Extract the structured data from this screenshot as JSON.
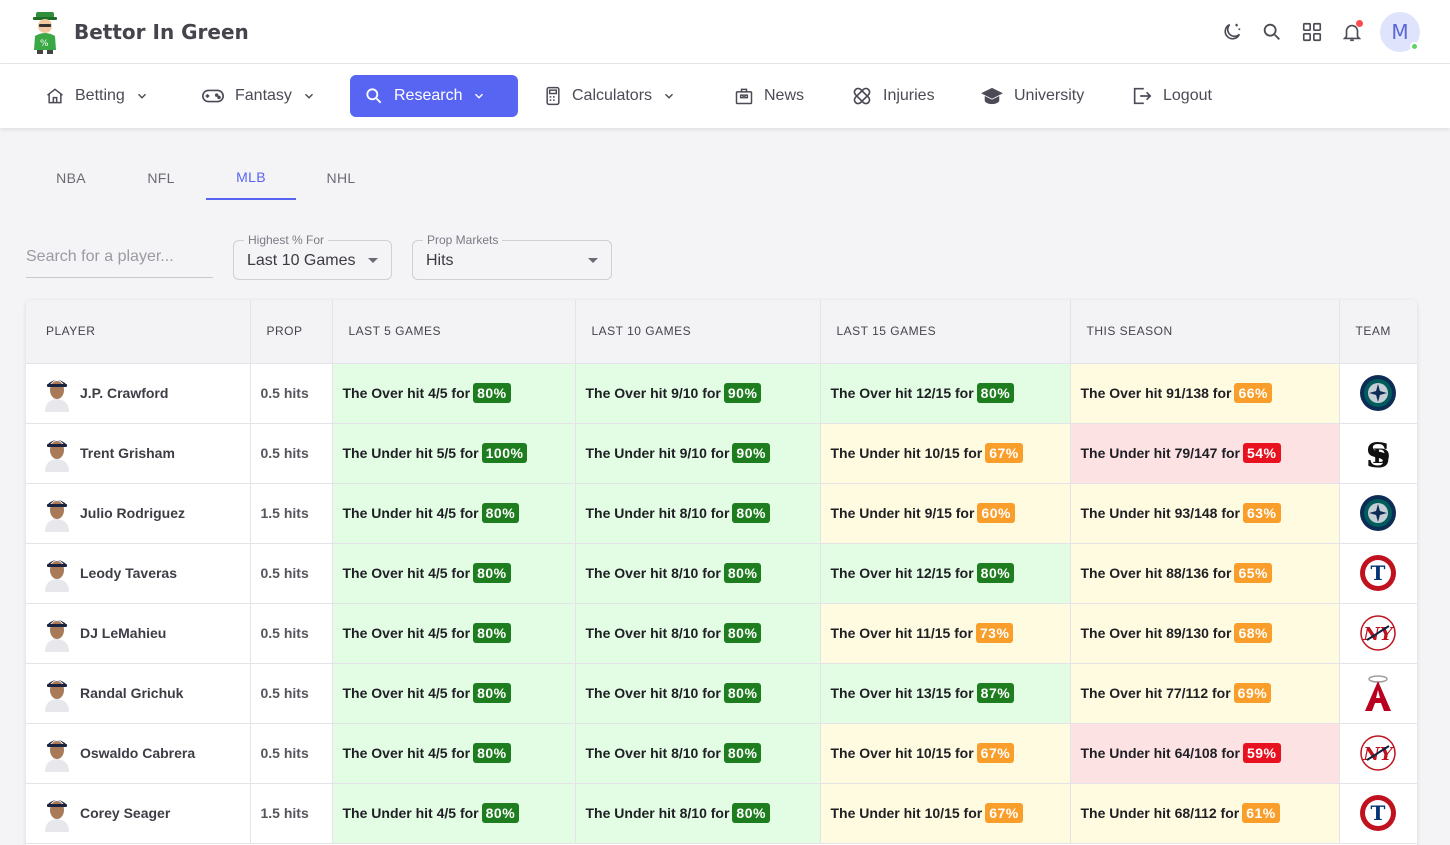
{
  "brand": {
    "name": "Bettor In Green"
  },
  "header": {
    "avatar_initial": "M"
  },
  "nav": [
    {
      "label": "Betting",
      "icon": "home-icon",
      "dropdown": true
    },
    {
      "label": "Fantasy",
      "icon": "gamepad-icon",
      "dropdown": true
    },
    {
      "label": "Research",
      "icon": "search-icon",
      "dropdown": true,
      "active": true
    },
    {
      "label": "Calculators",
      "icon": "calculator-icon",
      "dropdown": true
    },
    {
      "label": "News",
      "icon": "briefcase-icon",
      "dropdown": false
    },
    {
      "label": "Injuries",
      "icon": "bandage-icon",
      "dropdown": false
    },
    {
      "label": "University",
      "icon": "graduation-cap-icon",
      "dropdown": false
    },
    {
      "label": "Logout",
      "icon": "logout-icon",
      "dropdown": false
    }
  ],
  "sport_tabs": [
    "NBA",
    "NFL",
    "MLB",
    "NHL"
  ],
  "active_sport": "MLB",
  "filters": {
    "search_placeholder": "Search for a player...",
    "highest_label": "Highest % For",
    "highest_value": "Last 10 Games",
    "market_label": "Prop Markets",
    "market_value": "Hits"
  },
  "table": {
    "columns": [
      "PLAYER",
      "PROP",
      "LAST 5 GAMES",
      "LAST 10 GAMES",
      "LAST 15 GAMES",
      "THIS SEASON",
      "TEAM"
    ],
    "rows": [
      {
        "player": "J.P. Crawford",
        "prop": "0.5 hits",
        "team": "SEA",
        "l5": {
          "text": "The Over hit 4/5 for",
          "pct": "80%"
        },
        "l10": {
          "text": "The Over hit 9/10 for",
          "pct": "90%"
        },
        "l15": {
          "text": "The Over hit 12/15 for",
          "pct": "80%"
        },
        "season": {
          "text": "The Over hit 91/138 for",
          "pct": "66%"
        }
      },
      {
        "player": "Trent Grisham",
        "prop": "0.5 hits",
        "team": "SD",
        "l5": {
          "text": "The Under hit 5/5 for",
          "pct": "100%"
        },
        "l10": {
          "text": "The Under hit 9/10 for",
          "pct": "90%"
        },
        "l15": {
          "text": "The Under hit 10/15 for",
          "pct": "67%"
        },
        "season": {
          "text": "The Under hit 79/147 for",
          "pct": "54%"
        }
      },
      {
        "player": "Julio Rodriguez",
        "prop": "1.5 hits",
        "team": "SEA",
        "l5": {
          "text": "The Under hit 4/5 for",
          "pct": "80%"
        },
        "l10": {
          "text": "The Under hit 8/10 for",
          "pct": "80%"
        },
        "l15": {
          "text": "The Under hit 9/15 for",
          "pct": "60%"
        },
        "season": {
          "text": "The Under hit 93/148 for",
          "pct": "63%"
        }
      },
      {
        "player": "Leody Taveras",
        "prop": "0.5 hits",
        "team": "TEX",
        "l5": {
          "text": "The Over hit 4/5 for",
          "pct": "80%"
        },
        "l10": {
          "text": "The Over hit 8/10 for",
          "pct": "80%"
        },
        "l15": {
          "text": "The Over hit 12/15 for",
          "pct": "80%"
        },
        "season": {
          "text": "The Over hit 88/136 for",
          "pct": "65%"
        }
      },
      {
        "player": "DJ LeMahieu",
        "prop": "0.5 hits",
        "team": "NYY",
        "l5": {
          "text": "The Over hit 4/5 for",
          "pct": "80%"
        },
        "l10": {
          "text": "The Over hit 8/10 for",
          "pct": "80%"
        },
        "l15": {
          "text": "The Over hit 11/15 for",
          "pct": "73%"
        },
        "season": {
          "text": "The Over hit 89/130 for",
          "pct": "68%"
        }
      },
      {
        "player": "Randal Grichuk",
        "prop": "0.5 hits",
        "team": "LAA",
        "l5": {
          "text": "The Over hit 4/5 for",
          "pct": "80%"
        },
        "l10": {
          "text": "The Over hit 8/10 for",
          "pct": "80%"
        },
        "l15": {
          "text": "The Over hit 13/15 for",
          "pct": "87%"
        },
        "season": {
          "text": "The Over hit 77/112 for",
          "pct": "69%"
        }
      },
      {
        "player": "Oswaldo Cabrera",
        "prop": "0.5 hits",
        "team": "NYY",
        "l5": {
          "text": "The Over hit 4/5 for",
          "pct": "80%"
        },
        "l10": {
          "text": "The Over hit 8/10 for",
          "pct": "80%"
        },
        "l15": {
          "text": "The Over hit 10/15 for",
          "pct": "67%"
        },
        "season": {
          "text": "The Under hit 64/108 for",
          "pct": "59%"
        }
      },
      {
        "player": "Corey Seager",
        "prop": "1.5 hits",
        "team": "TEX",
        "l5": {
          "text": "The Under hit 4/5 for",
          "pct": "80%"
        },
        "l10": {
          "text": "The Under hit 8/10 for",
          "pct": "80%"
        },
        "l15": {
          "text": "The Under hit 10/15 for",
          "pct": "67%"
        },
        "season": {
          "text": "The Under hit 68/112 for",
          "pct": "61%"
        }
      }
    ]
  },
  "colors": {
    "accent": "#5865f2",
    "pct_green": "#1e7d1e",
    "pct_orange": "#f99e2a",
    "pct_red": "#e8111f",
    "cell_green": "#e2fde3",
    "cell_yellow": "#fffbe0",
    "cell_red": "#fde2e3"
  }
}
